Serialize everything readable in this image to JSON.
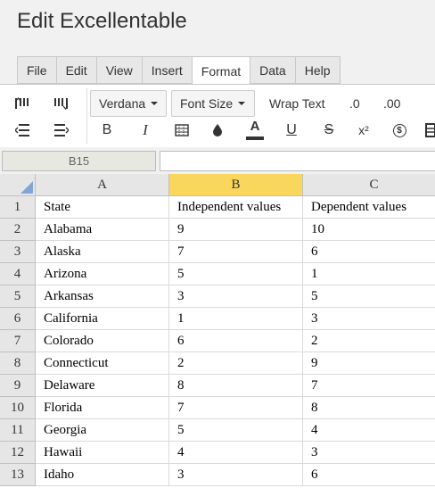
{
  "app": {
    "title": "Edit Excellentable"
  },
  "menu": {
    "tabs": [
      {
        "label": "File"
      },
      {
        "label": "Edit"
      },
      {
        "label": "View"
      },
      {
        "label": "Insert"
      },
      {
        "label": "Format",
        "active": true
      },
      {
        "label": "Data"
      },
      {
        "label": "Help"
      }
    ]
  },
  "toolbar": {
    "font_family": "Verdana",
    "font_size_label": "Font Size",
    "wrap_text_label": "Wrap Text",
    "decimal_decrease_label": ".0",
    "decimal_increase_label": ".00",
    "bold_label": "B",
    "italic_label": "I",
    "strike_label": "S",
    "font_color_label": "A",
    "underline_label": "U",
    "superscript_label": "x²",
    "currency_label": "$",
    "font_color_bar": "#333333",
    "icons": [
      "indent-increase-icon",
      "indent-decrease-icon",
      "align-left-icon",
      "align-right-icon",
      "bold-icon",
      "italic-icon",
      "borders-icon",
      "fill-color-icon",
      "font-color-icon",
      "underline-icon",
      "strikethrough-icon",
      "superscript-icon",
      "currency-icon",
      "more-icon"
    ]
  },
  "namebox": {
    "value": "B15"
  },
  "formula_bar": {
    "value": ""
  },
  "sheet": {
    "selected_column": "B",
    "columns": [
      "A",
      "B",
      "C"
    ],
    "rows": [
      {
        "num": "1",
        "cells": [
          "State",
          "Independent values",
          "Dependent values"
        ]
      },
      {
        "num": "2",
        "cells": [
          "Alabama",
          "9",
          "10"
        ]
      },
      {
        "num": "3",
        "cells": [
          "Alaska",
          "7",
          "6"
        ]
      },
      {
        "num": "4",
        "cells": [
          "Arizona",
          "5",
          "1"
        ]
      },
      {
        "num": "5",
        "cells": [
          "Arkansas",
          "3",
          "5"
        ]
      },
      {
        "num": "6",
        "cells": [
          "California",
          "1",
          "3"
        ]
      },
      {
        "num": "7",
        "cells": [
          "Colorado",
          "6",
          "2"
        ]
      },
      {
        "num": "8",
        "cells": [
          "Connecticut",
          "2",
          "9"
        ]
      },
      {
        "num": "9",
        "cells": [
          "Delaware",
          "8",
          "7"
        ]
      },
      {
        "num": "10",
        "cells": [
          "Florida",
          "7",
          "8"
        ]
      },
      {
        "num": "11",
        "cells": [
          "Georgia",
          "5",
          "4"
        ]
      },
      {
        "num": "12",
        "cells": [
          "Hawaii",
          "4",
          "3"
        ]
      },
      {
        "num": "13",
        "cells": [
          "Idaho",
          "3",
          "6"
        ]
      }
    ]
  },
  "colors": {
    "selected_header": "#f9d65c",
    "corner_accent": "#7fa7d6"
  }
}
